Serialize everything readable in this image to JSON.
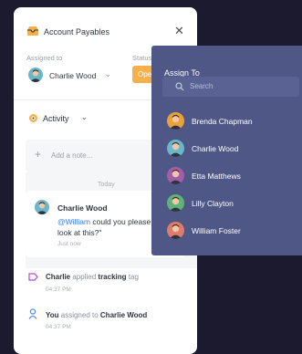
{
  "card": {
    "title": "Account Payables",
    "assigned_label": "Assigned to",
    "assignee": "Charlie Wood",
    "status_label": "Status",
    "status_value": "Ope"
  },
  "activity": {
    "title": "Activity",
    "note_placeholder": "Add a note...",
    "date_divider": "Today",
    "comment": {
      "author": "Charlie Wood",
      "mention": "@William",
      "text_line1_rest": " could you please t",
      "text_line2": "look at this?\"",
      "time": "Just now"
    },
    "log": [
      {
        "actor": "Charlie",
        "verb": "applied",
        "object": "tracking",
        "suffix": "tag",
        "time": "04:37 PM"
      },
      {
        "actor": "You",
        "verb": "assigned to",
        "object": "Charlie Wood",
        "suffix": "",
        "time": "04:37 PM"
      }
    ]
  },
  "assign_popover": {
    "title": "Assign To",
    "search_placeholder": "Search",
    "people": [
      {
        "name": "Brenda Chapman",
        "avatar_color": "#e8a23a"
      },
      {
        "name": "Charlie Wood",
        "avatar_color": "#6bb6c9"
      },
      {
        "name": "Etta Matthews",
        "avatar_color": "#a35ea8"
      },
      {
        "name": "Lilly Clayton",
        "avatar_color": "#5fb37a"
      },
      {
        "name": "William Foster",
        "avatar_color": "#e07a6a"
      }
    ]
  },
  "colors": {
    "background": "#1c1a2e",
    "popover": "#4f5787",
    "status": "#f5b04a",
    "mention": "#3e7ef5",
    "tag_icon": "#b54ad6",
    "user_icon": "#3e7ef5"
  }
}
